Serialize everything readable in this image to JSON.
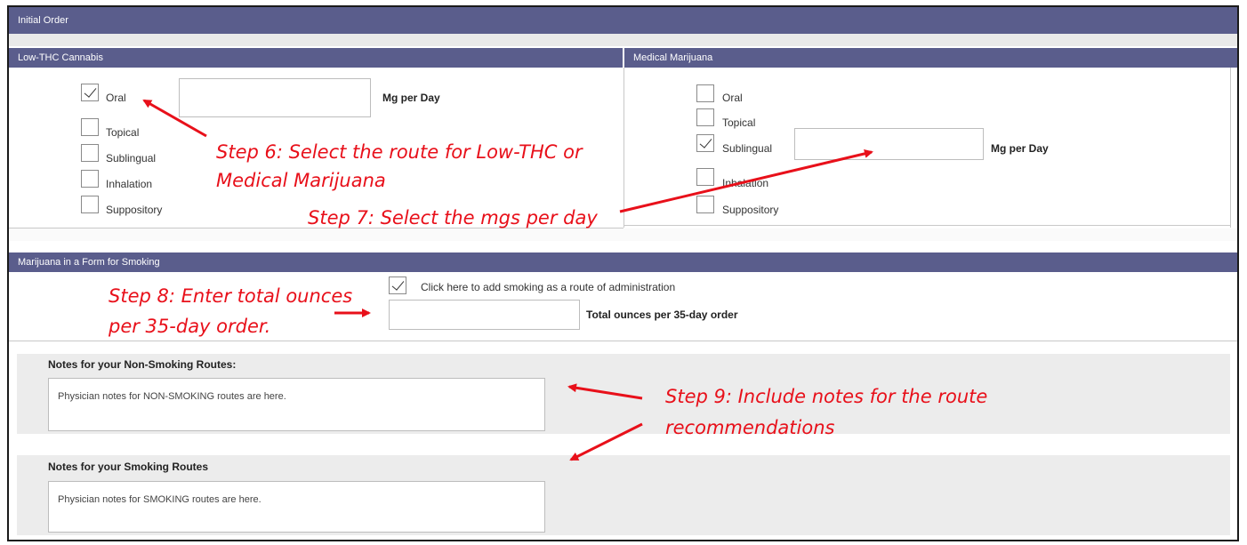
{
  "initial_order": {
    "title": "Initial Order"
  },
  "low_thc": {
    "title": "Low-THC Cannabis",
    "routes": [
      {
        "label": "Oral",
        "checked": true
      },
      {
        "label": "Topical",
        "checked": false
      },
      {
        "label": "Sublingual",
        "checked": false
      },
      {
        "label": "Inhalation",
        "checked": false
      },
      {
        "label": "Suppository",
        "checked": false
      }
    ],
    "mg_label": "Mg per Day",
    "mg_value": ""
  },
  "medical": {
    "title": "Medical Marijuana",
    "routes": [
      {
        "label": "Oral",
        "checked": false
      },
      {
        "label": "Topical",
        "checked": false
      },
      {
        "label": "Sublingual",
        "checked": true
      },
      {
        "label": "Inhalation",
        "checked": false
      },
      {
        "label": "Suppository",
        "checked": false
      }
    ],
    "mg_label": "Mg per Day",
    "mg_value": ""
  },
  "smoking": {
    "title": "Marijuana in a Form for Smoking",
    "checkbox_label": "Click here to add smoking as a route of administration",
    "checked": true,
    "ounces_label": "Total ounces per 35-day order",
    "ounces_value": ""
  },
  "notes": {
    "non_smoking_label": "Notes for your Non-Smoking Routes:",
    "non_smoking_text": "Physician notes for NON-SMOKING routes are here.",
    "smoking_label": "Notes for your Smoking Routes",
    "smoking_text": "Physician notes for SMOKING routes are here."
  },
  "annotations": {
    "step6_line1": "Step 6: Select the route for Low-THC or",
    "step6_line2": "Medical Marijuana",
    "step7": "Step 7: Select the mgs per day",
    "step8_line1": "Step 8: Enter total ounces",
    "step8_line2": "per 35-day order.",
    "step9_line1": "Step 9: Include notes for the route",
    "step9_line2": "recommendations"
  },
  "colors": {
    "header_bar": "#5a5d8c",
    "annotation": "#e8101a",
    "notes_bg": "#ececec"
  }
}
